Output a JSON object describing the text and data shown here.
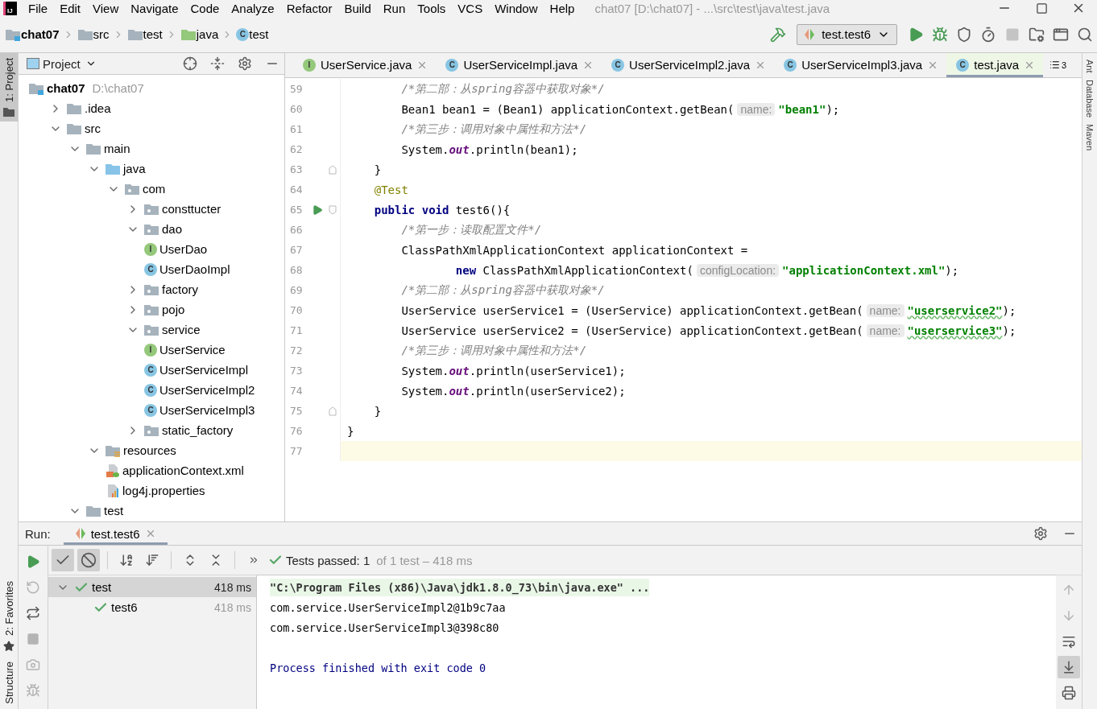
{
  "menu_bar": {
    "logo": "IJ",
    "items": [
      "File",
      "Edit",
      "View",
      "Navigate",
      "Code",
      "Analyze",
      "Refactor",
      "Build",
      "Run",
      "Tools",
      "VCS",
      "Window",
      "Help"
    ],
    "title": "chat07 [D:\\chat07] - ...\\src\\test\\java\\test.java"
  },
  "breadcrumbs": [
    {
      "label": "chat07",
      "kind": "project"
    },
    {
      "label": "src",
      "kind": "folder"
    },
    {
      "label": "test",
      "kind": "folder"
    },
    {
      "label": "java",
      "kind": "test-root"
    },
    {
      "label": "test",
      "kind": "class",
      "icon_text": "C"
    }
  ],
  "run_config": "test.test6",
  "left_stripe": [
    {
      "label": "1: Project",
      "selected": true
    },
    {
      "label": "2: Favorites",
      "selected": false
    },
    {
      "label": "Structure",
      "selected": false
    }
  ],
  "right_stripe": [
    "Ant",
    "Database",
    "Maven"
  ],
  "project_panel": {
    "title": "Project",
    "tree": [
      {
        "name": "chat07",
        "path": "D:\\chat07",
        "kind": "project",
        "children": [
          {
            "name": ".idea",
            "kind": "folder",
            "expanded": false
          },
          {
            "name": "src",
            "kind": "folder",
            "expanded": true,
            "children": [
              {
                "name": "main",
                "kind": "folder",
                "expanded": true,
                "children": [
                  {
                    "name": "java",
                    "kind": "source-root",
                    "expanded": true,
                    "children": [
                      {
                        "name": "com",
                        "kind": "package",
                        "expanded": true,
                        "children": [
                          {
                            "name": "consttucter",
                            "kind": "package",
                            "expanded": false
                          },
                          {
                            "name": "dao",
                            "kind": "package",
                            "expanded": true,
                            "children": [
                              {
                                "name": "UserDao",
                                "kind": "interface",
                                "icon_text": "I"
                              },
                              {
                                "name": "UserDaoImpl",
                                "kind": "class",
                                "icon_text": "C"
                              }
                            ]
                          },
                          {
                            "name": "factory",
                            "kind": "package",
                            "expanded": false
                          },
                          {
                            "name": "pojo",
                            "kind": "package",
                            "expanded": false
                          },
                          {
                            "name": "service",
                            "kind": "package",
                            "expanded": true,
                            "children": [
                              {
                                "name": "UserService",
                                "kind": "interface",
                                "icon_text": "I"
                              },
                              {
                                "name": "UserServiceImpl",
                                "kind": "class",
                                "icon_text": "C"
                              },
                              {
                                "name": "UserServiceImpl2",
                                "kind": "class",
                                "icon_text": "C"
                              },
                              {
                                "name": "UserServiceImpl3",
                                "kind": "class",
                                "icon_text": "C"
                              }
                            ]
                          },
                          {
                            "name": "static_factory",
                            "kind": "package",
                            "expanded": false
                          }
                        ]
                      }
                    ]
                  },
                  {
                    "name": "resources",
                    "kind": "resources",
                    "expanded": true,
                    "children": [
                      {
                        "name": "applicationContext.xml",
                        "kind": "xml"
                      },
                      {
                        "name": "log4j.properties",
                        "kind": "properties"
                      }
                    ]
                  }
                ]
              },
              {
                "name": "test",
                "kind": "folder",
                "expanded": true
              }
            ]
          }
        ]
      }
    ]
  },
  "editor": {
    "tabs": [
      {
        "label": "UserService.java",
        "kind": "interface",
        "icon_text": "I",
        "selected": false
      },
      {
        "label": "UserServiceImpl.java",
        "kind": "class",
        "icon_text": "C",
        "selected": false
      },
      {
        "label": "UserServiceImpl2.java",
        "kind": "class",
        "icon_text": "C",
        "selected": false
      },
      {
        "label": "UserServiceImpl3.java",
        "kind": "class",
        "icon_text": "C",
        "selected": false
      },
      {
        "label": "test.java",
        "kind": "class",
        "icon_text": "C",
        "selected": true
      }
    ],
    "tab_overflow": "3",
    "lines": [
      {
        "number": "59",
        "kind": "plain",
        "current": false,
        "segments": [
          {
            "kind": "comment",
            "text": "        /*第二部：从spring容器中获取对象*/"
          }
        ]
      },
      {
        "number": "60",
        "kind": "plain",
        "current": false,
        "segments": [
          {
            "kind": "plain",
            "text": "        Bean1 bean1 = (Bean1) applicationContext.getBean("
          },
          {
            "kind": "hint",
            "text": "name:"
          },
          {
            "kind": "string",
            "text": "\"bean1\"",
            "typo": false
          },
          {
            "kind": "plain",
            "text": ");"
          }
        ]
      },
      {
        "number": "61",
        "kind": "plain",
        "current": false,
        "segments": [
          {
            "kind": "comment",
            "text": "        /*第三步：调用对象中属性和方法*/"
          }
        ]
      },
      {
        "number": "62",
        "kind": "plain",
        "current": false,
        "segments": [
          {
            "kind": "plain",
            "text": "        System."
          },
          {
            "kind": "static",
            "text": "out"
          },
          {
            "kind": "plain",
            "text": ".println(bean1);"
          }
        ]
      },
      {
        "number": "63",
        "kind": "fold-end",
        "current": false,
        "segments": [
          {
            "kind": "plain",
            "text": "    }"
          }
        ]
      },
      {
        "number": "64",
        "kind": "plain",
        "current": false,
        "segments": [
          {
            "kind": "annotation",
            "text": "    @Test"
          }
        ]
      },
      {
        "number": "65",
        "kind": "test-start",
        "current": false,
        "segments": [
          {
            "kind": "keyword",
            "text": "    public void"
          },
          {
            "kind": "plain",
            "text": " test6(){"
          }
        ]
      },
      {
        "number": "66",
        "kind": "plain",
        "current": false,
        "segments": [
          {
            "kind": "comment",
            "text": "        /*第一步：读取配置文件*/"
          }
        ]
      },
      {
        "number": "67",
        "kind": "plain",
        "current": false,
        "segments": [
          {
            "kind": "plain",
            "text": "        ClassPathXmlApplicationContext applicationContext ="
          }
        ]
      },
      {
        "number": "68",
        "kind": "plain",
        "current": false,
        "segments": [
          {
            "kind": "keyword",
            "text": "                new"
          },
          {
            "kind": "plain",
            "text": " ClassPathXmlApplicationContext("
          },
          {
            "kind": "hint",
            "text": "configLocation:"
          },
          {
            "kind": "string",
            "text": "\"applicationContext.xml\"",
            "typo": false
          },
          {
            "kind": "plain",
            "text": ");"
          }
        ]
      },
      {
        "number": "69",
        "kind": "plain",
        "current": false,
        "segments": [
          {
            "kind": "comment",
            "text": "        /*第二部：从spring容器中获取对象*/"
          }
        ]
      },
      {
        "number": "70",
        "kind": "plain",
        "current": false,
        "segments": [
          {
            "kind": "plain",
            "text": "        UserService userService1 = (UserService) applicationContext.getBean("
          },
          {
            "kind": "hint",
            "text": "name:"
          },
          {
            "kind": "string",
            "text": "\"userservice2\"",
            "typo": true
          },
          {
            "kind": "plain",
            "text": ");"
          }
        ]
      },
      {
        "number": "71",
        "kind": "plain",
        "current": false,
        "segments": [
          {
            "kind": "plain",
            "text": "        UserService userService2 = (UserService) applicationContext.getBean("
          },
          {
            "kind": "hint",
            "text": "name:"
          },
          {
            "kind": "string",
            "text": "\"userservice3\"",
            "typo": true
          },
          {
            "kind": "plain",
            "text": ");"
          }
        ]
      },
      {
        "number": "72",
        "kind": "plain",
        "current": false,
        "segments": [
          {
            "kind": "comment",
            "text": "        /*第三步：调用对象中属性和方法*/"
          }
        ]
      },
      {
        "number": "73",
        "kind": "plain",
        "current": false,
        "segments": [
          {
            "kind": "plain",
            "text": "        System."
          },
          {
            "kind": "static",
            "text": "out"
          },
          {
            "kind": "plain",
            "text": ".println(userService1);"
          }
        ]
      },
      {
        "number": "74",
        "kind": "plain",
        "current": false,
        "segments": [
          {
            "kind": "plain",
            "text": "        System."
          },
          {
            "kind": "static",
            "text": "out"
          },
          {
            "kind": "plain",
            "text": ".println(userService2);"
          }
        ]
      },
      {
        "number": "75",
        "kind": "fold-end",
        "current": false,
        "segments": [
          {
            "kind": "plain",
            "text": "    }"
          }
        ]
      },
      {
        "number": "76",
        "kind": "plain",
        "current": false,
        "segments": [
          {
            "kind": "plain",
            "text": "}"
          }
        ]
      },
      {
        "number": "77",
        "kind": "plain",
        "current": true
      }
    ]
  },
  "run_panel": {
    "label": "Run:",
    "tab": "test.test6",
    "side_tools": [
      {
        "kind": "run",
        "disabled": false
      },
      {
        "kind": "rerun-failed",
        "disabled": true
      },
      {
        "kind": "toggle",
        "disabled": false
      },
      {
        "kind": "stop",
        "disabled": true
      },
      {
        "kind": "camera",
        "disabled": true
      },
      {
        "kind": "debug",
        "disabled": true
      }
    ],
    "filters": [
      {
        "kind": "passed",
        "selected": true
      },
      {
        "kind": "ignored",
        "selected": true
      }
    ],
    "status": {
      "passed": "Tests passed: 1",
      "detail": "of 1 test – 418 ms"
    },
    "tests": [
      {
        "name": "test",
        "time": "418 ms",
        "selected": true,
        "expanded": true,
        "children": [
          {
            "name": "test6",
            "time": "418 ms",
            "selected": false
          }
        ]
      }
    ],
    "console": [
      {
        "kind": "command",
        "text": "\"C:\\Program Files (x86)\\Java\\jdk1.8.0_73\\bin\\java.exe\" ..."
      },
      {
        "kind": "output",
        "text": "com.service.UserServiceImpl2@1b9c7aa"
      },
      {
        "kind": "output",
        "text": "com.service.UserServiceImpl3@398c80"
      },
      {
        "kind": "exit",
        "text": "Process finished with exit code 0"
      }
    ],
    "console_tools": [
      {
        "kind": "up",
        "disabled": true,
        "selected": false
      },
      {
        "kind": "down",
        "disabled": true,
        "selected": false
      },
      {
        "kind": "wrap",
        "disabled": false,
        "selected": false
      },
      {
        "kind": "scroll-end",
        "disabled": false,
        "selected": true
      },
      {
        "kind": "print",
        "disabled": false,
        "selected": false
      }
    ]
  }
}
